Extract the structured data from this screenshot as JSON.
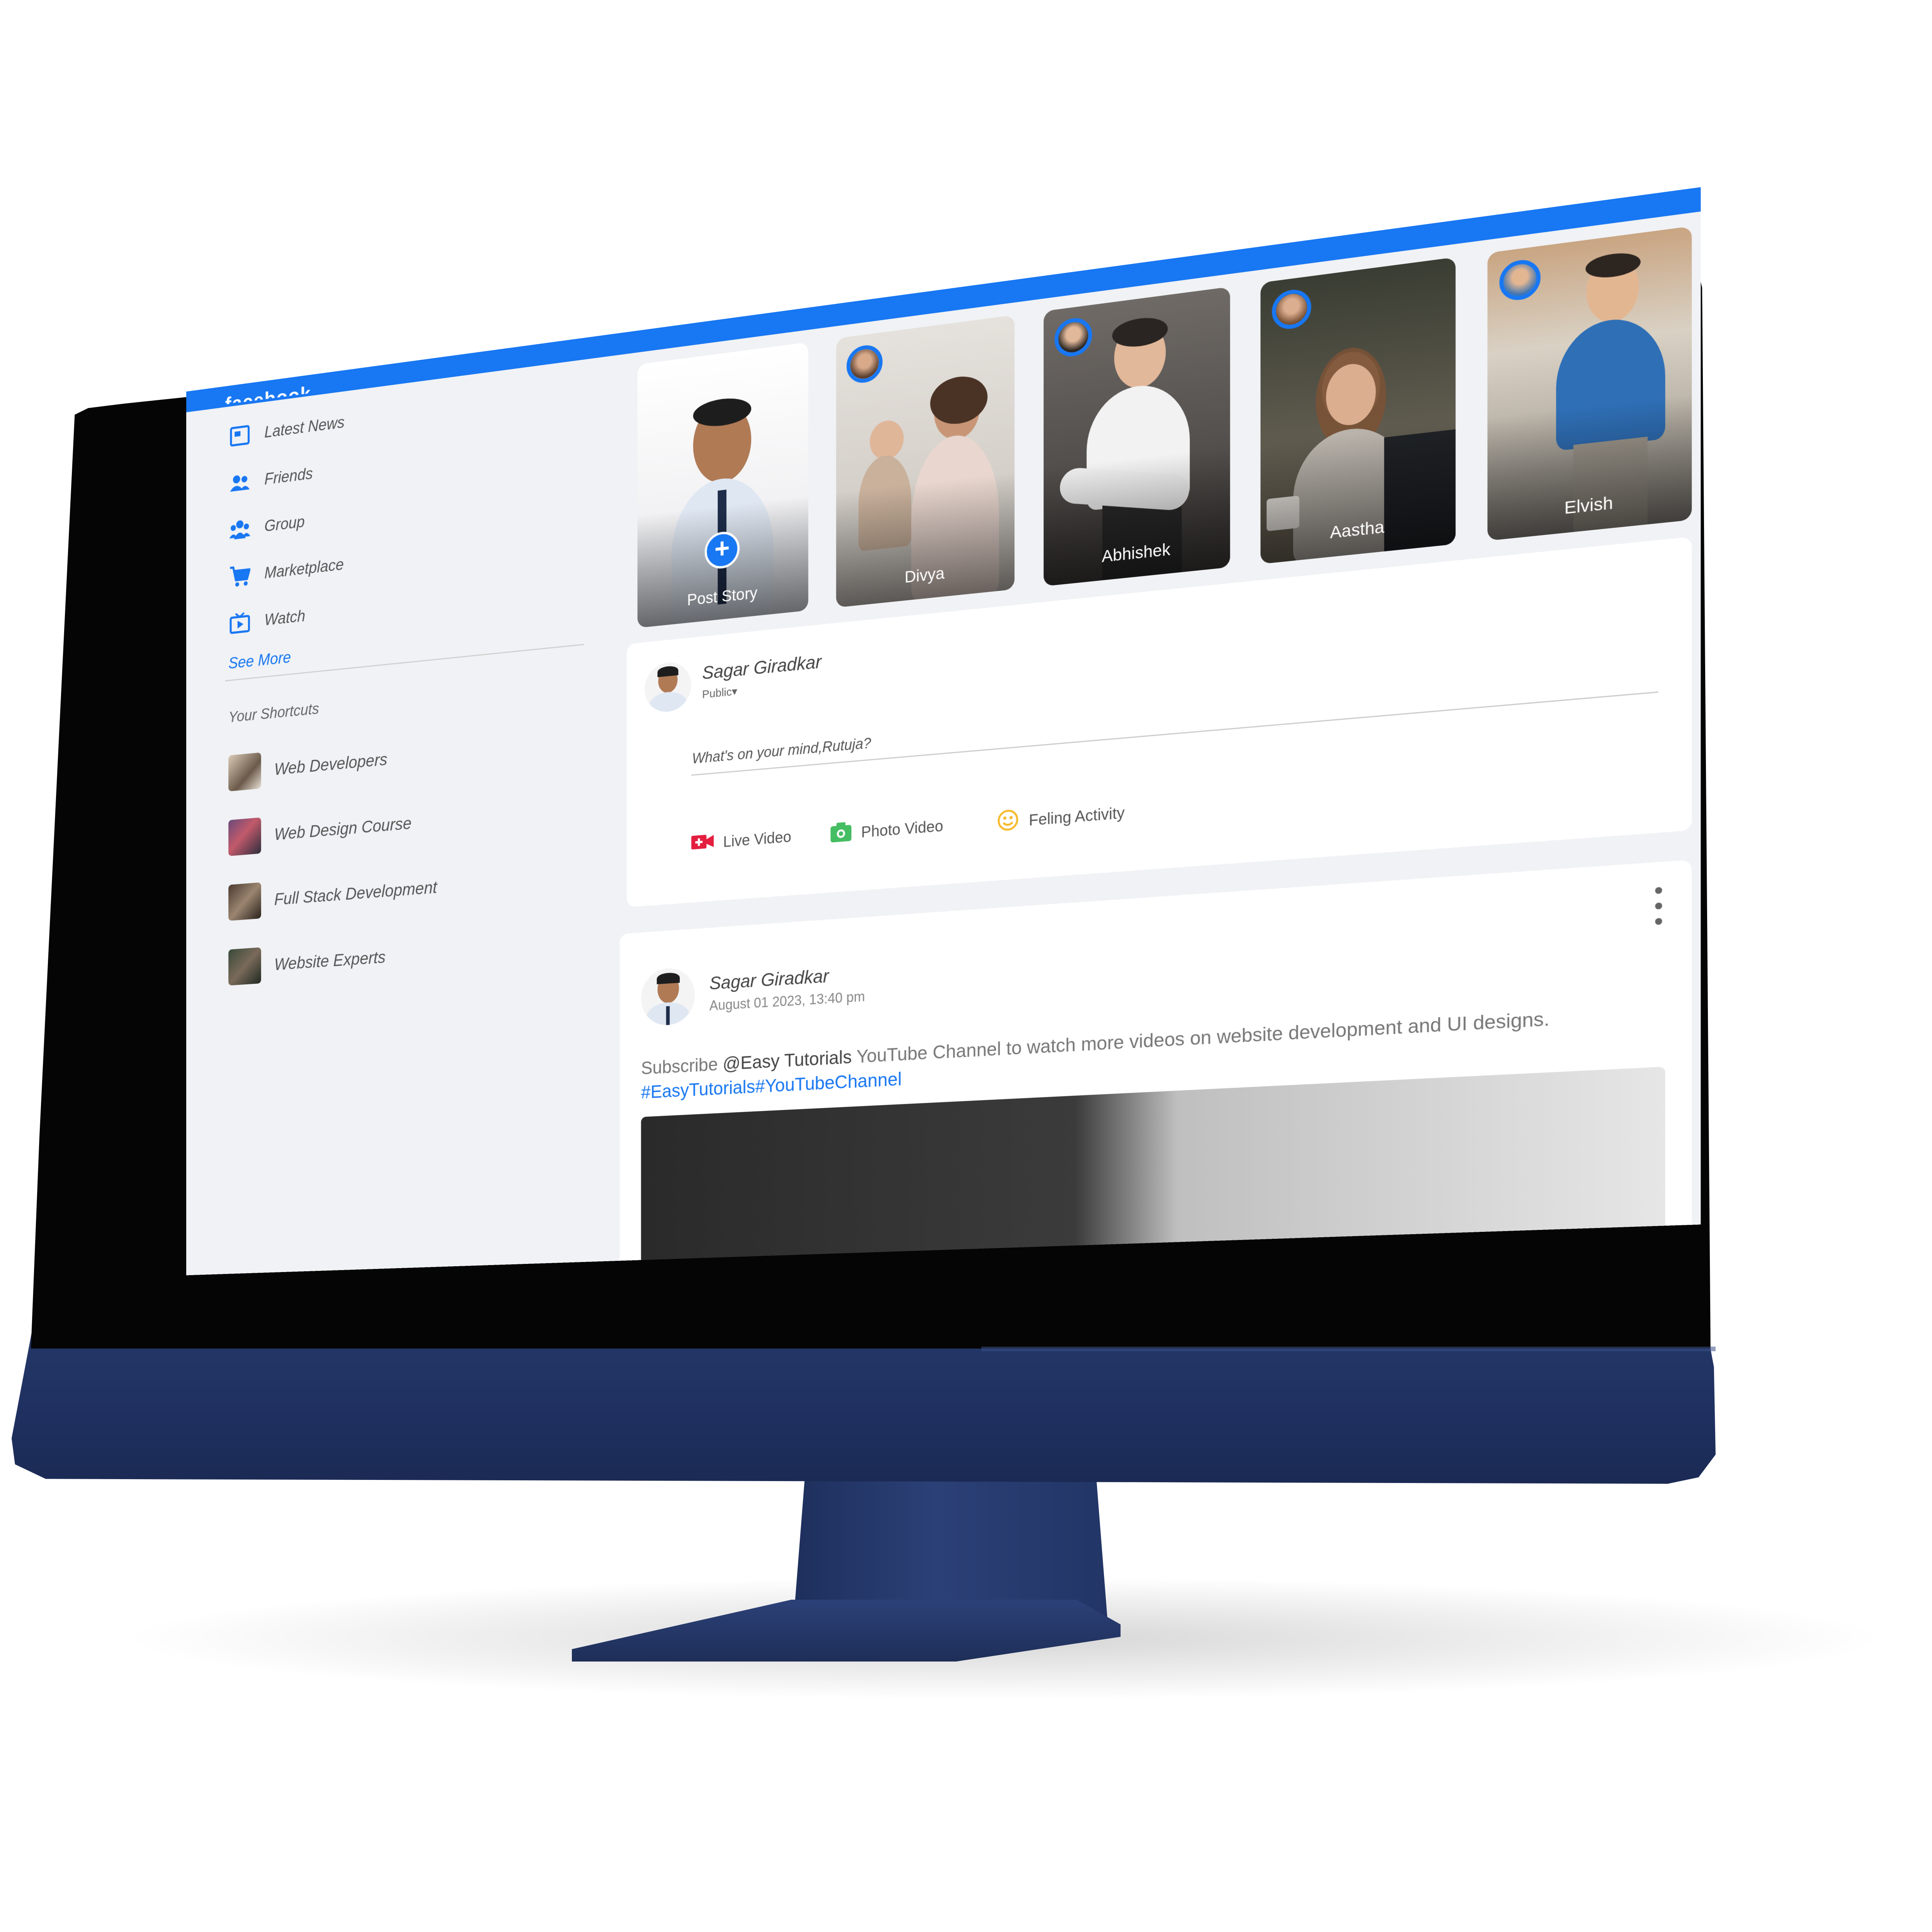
{
  "app": {
    "brand": "facebook",
    "accent": "#1877f2"
  },
  "sidebar": {
    "items": [
      {
        "label": "Latest News",
        "icon": "newspaper-icon"
      },
      {
        "label": "Friends",
        "icon": "friends-icon"
      },
      {
        "label": "Group",
        "icon": "group-icon"
      },
      {
        "label": "Marketplace",
        "icon": "cart-icon"
      },
      {
        "label": "Watch",
        "icon": "tv-icon"
      }
    ],
    "see_more": "See More",
    "shortcuts_title": "Your Shortcuts",
    "shortcuts": [
      {
        "label": "Web Developers"
      },
      {
        "label": "Web Design Course"
      },
      {
        "label": "Full Stack Development"
      },
      {
        "label": "Website Experts"
      }
    ]
  },
  "stories": [
    {
      "name": "Post Story",
      "add": "+"
    },
    {
      "name": "Divya"
    },
    {
      "name": "Abhishek"
    },
    {
      "name": "Aastha"
    },
    {
      "name": "Elvish"
    }
  ],
  "composer": {
    "user": "Sagar Giradkar",
    "visibility": "Public",
    "placeholder": "What's on your mind,Rutuja?",
    "actions": [
      {
        "label": "Live Video",
        "icon": "live-video-icon",
        "color": "#e41e3f"
      },
      {
        "label": "Photo Video",
        "icon": "photo-icon",
        "color": "#45bd62"
      },
      {
        "label": "Feling Activity",
        "icon": "smile-icon",
        "color": "#f7b928"
      }
    ]
  },
  "post": {
    "user": "Sagar Giradkar",
    "time": "August 01 2023, 13:40 pm",
    "text_prefix": "Subscribe ",
    "mention": "@Easy Tutorials",
    "text_suffix": " YouTube Channel to watch more videos on website development and UI designs.",
    "tags": "#EasyTutorials#YouTubeChannel"
  }
}
